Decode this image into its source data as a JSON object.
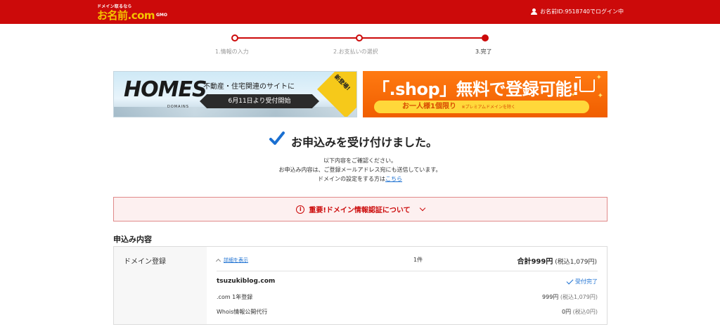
{
  "header": {
    "logo_tagline": "ドメイン取るなら",
    "logo_main": "お名前.com",
    "logo_brand": "GMO",
    "login_text": "お名前ID:9518740でログイン中"
  },
  "stepper": {
    "steps": [
      {
        "label": "1.情報の入力"
      },
      {
        "label": "2.お支払いの選択"
      },
      {
        "label": "3.完了"
      }
    ],
    "current_step": 3
  },
  "banners": {
    "homes": {
      "logo": "HOMES",
      "logo_sub": "DOMAINS",
      "headline": "不動産・住宅関連のサイトに",
      "pill": "6月11日より受付開始",
      "badge": "新登場!"
    },
    "shop": {
      "headline": "「.shop」無料で登録可能!",
      "pill": "お一人様1個限り",
      "note": "※プレミアムドメインを除く"
    }
  },
  "confirmation": {
    "title": "お申込みを受け付けました。",
    "line1": "以下内容をご確認ください。",
    "line2": "お申込み内容は、ご登録メールアドレス宛にも送信しています。",
    "line3_prefix": "ドメインの設定をする方は",
    "line3_link": "こちら"
  },
  "notice": {
    "text": "重要!ドメイン情報認証について"
  },
  "order": {
    "section_title": "申込み内容",
    "category": "ドメイン登録",
    "detail_toggle": "詳細を表示",
    "quantity": "1件",
    "total_label": "合計999円",
    "total_tax": "(税込1,079円)",
    "domain": "tsuzukiblog.com",
    "status": "受付完了",
    "items": [
      {
        "label": ".com 1年登録",
        "price": "999円",
        "tax": "(税込1,079円)"
      },
      {
        "label": "Whois情報公開代行",
        "price": "0円",
        "tax": "(税込0円)"
      }
    ]
  },
  "colors": {
    "brand_red": "#cc0a0a",
    "logo_yellow": "#f5c400",
    "link_blue": "#1a6fd1",
    "shop_orange": "#f26a00"
  }
}
